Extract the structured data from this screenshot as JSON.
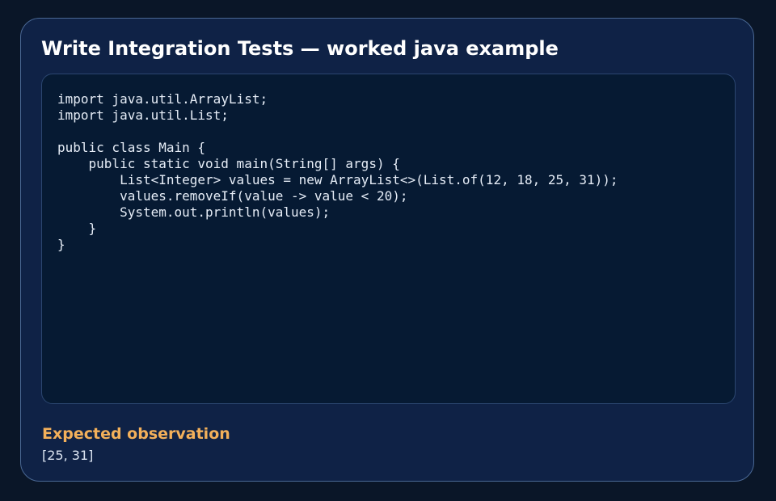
{
  "card": {
    "title": "Write Integration Tests — worked java example",
    "code": "import java.util.ArrayList;\nimport java.util.List;\n\npublic class Main {\n    public static void main(String[] args) {\n        List<Integer> values = new ArrayList<>(List.of(12, 18, 25, 31));\n        values.removeIf(value -> value < 20);\n        System.out.println(values);\n    }\n}",
    "observation_heading": "Expected observation",
    "observation_value": "[25, 31]"
  },
  "colors": {
    "page_background": "#0a1628",
    "card_background": "#0f2246",
    "code_background": "#061a33",
    "accent": "#f3b05a",
    "title_text": "#ffffff"
  }
}
